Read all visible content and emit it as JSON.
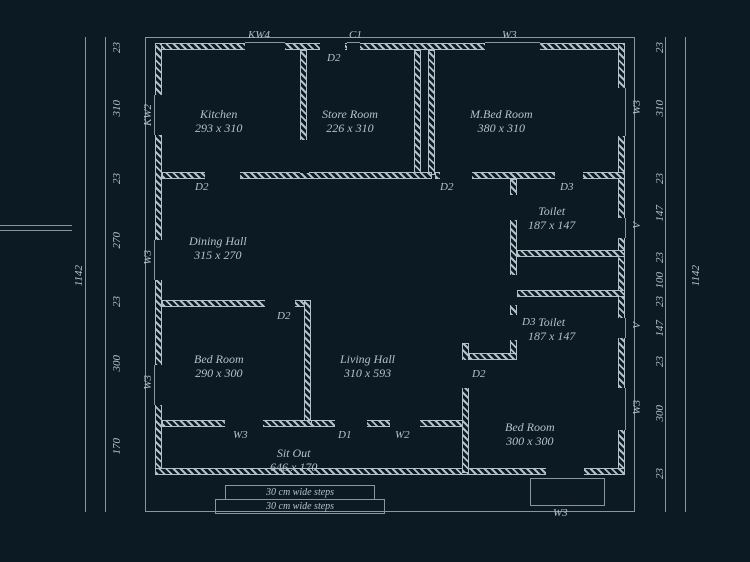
{
  "rooms": {
    "kitchen": {
      "name": "Kitchen",
      "dim": "293 x 310"
    },
    "store": {
      "name": "Store Room",
      "dim": "226 x 310"
    },
    "mbed": {
      "name": "M.Bed Room",
      "dim": "380 x 310"
    },
    "dining": {
      "name": "Dining Hall",
      "dim": "315 x 270"
    },
    "bed1": {
      "name": "Bed Room",
      "dim": "290 x 300"
    },
    "living": {
      "name": "Living Hall",
      "dim": "310 x 593"
    },
    "toilet1": {
      "name": "Toilet",
      "dim": "187 x 147"
    },
    "toilet2": {
      "name": "Toilet",
      "dim": "187 x 147"
    },
    "bed2": {
      "name": "Bed Room",
      "dim": "300 x 300"
    },
    "sitout": {
      "name": "Sit Out",
      "dim": "646 x 170"
    }
  },
  "doors": {
    "D1": "D1",
    "D2": "D2",
    "D3": "D3"
  },
  "windows": {
    "W2": "W2",
    "W3": "W3",
    "KW2": "KW2",
    "KW4": "KW4",
    "C1": "C1",
    "V": "V"
  },
  "dims_left": {
    "a": "23",
    "b": "310",
    "c": "23",
    "d": "270",
    "e": "23",
    "f": "300",
    "g": "170",
    "total": "1142"
  },
  "dims_right": {
    "a": "23",
    "b": "310",
    "c": "23",
    "d": "147",
    "e": "23",
    "f": "100",
    "g": "23",
    "h": "147",
    "i": "23",
    "j": "300",
    "k": "23",
    "total": "1142"
  },
  "steps": {
    "s1": "30 cm wide steps",
    "s2": "30 cm wide steps"
  }
}
